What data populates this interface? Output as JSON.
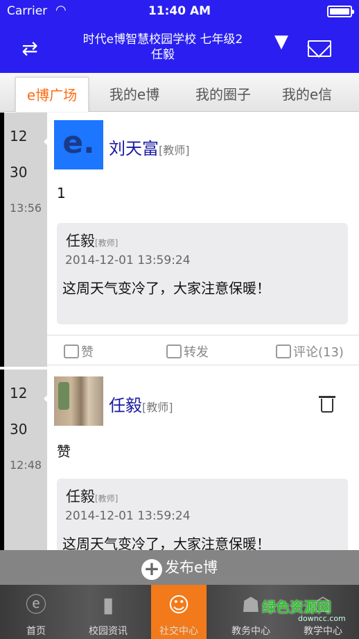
{
  "status_bar": {
    "carrier": "Carrier",
    "time": "11:40 AM"
  },
  "header": {
    "title_line1": "时代e博智慧校园学校 七年级2",
    "title_line2": "任毅",
    "switch_icon": "swap-arrows-icon",
    "dropdown_icon": "triangle-down-icon",
    "mail_icon": "envelope-icon"
  },
  "tabs": [
    {
      "label": "e博广场",
      "active": true
    },
    {
      "label": "我的e博",
      "active": false
    },
    {
      "label": "我的圈子",
      "active": false
    },
    {
      "label": "我的e信",
      "active": false
    }
  ],
  "posts": [
    {
      "date_month": "12",
      "date_day": "30",
      "time": "13:56",
      "author": "刘天富",
      "role": "[教师]",
      "avatar_text": "e.",
      "content": "1",
      "quote": {
        "author": "任毅",
        "role": "[教师]",
        "timestamp": "2014-12-01 13:59:24",
        "text": "这周天气变冷了，大家注意保暖！"
      },
      "actions": {
        "like": "赞",
        "forward": "转发",
        "comment": "评论(13)"
      }
    },
    {
      "date_month": "12",
      "date_day": "30",
      "time": "12:48",
      "author": "任毅",
      "role": "[教师]",
      "content": "赞",
      "quote": {
        "author": "任毅",
        "role": "[教师]",
        "timestamp": "2014-12-01 13:59:24",
        "text": "这周天气变冷了，大家注意保暖！"
      }
    }
  ],
  "publish": {
    "label": "发布e博"
  },
  "bottom_nav": [
    {
      "label": "首页",
      "icon": "e-logo-icon",
      "active": false
    },
    {
      "label": "校园资讯",
      "icon": "book-icon",
      "active": false
    },
    {
      "label": "社交中心",
      "icon": "chat-people-icon",
      "active": true
    },
    {
      "label": "教务中心",
      "icon": "person-board-icon",
      "active": false
    },
    {
      "label": "教学中心",
      "icon": "teacher-icon",
      "active": false
    }
  ],
  "watermark": {
    "text": "绿色资源网",
    "sub": "downcc.com"
  },
  "colors": {
    "header_bg": "#2a1ff0",
    "active_tab": "#ff6a14",
    "nav_active": "#f27a1a",
    "name_color": "#1a1aa0"
  }
}
